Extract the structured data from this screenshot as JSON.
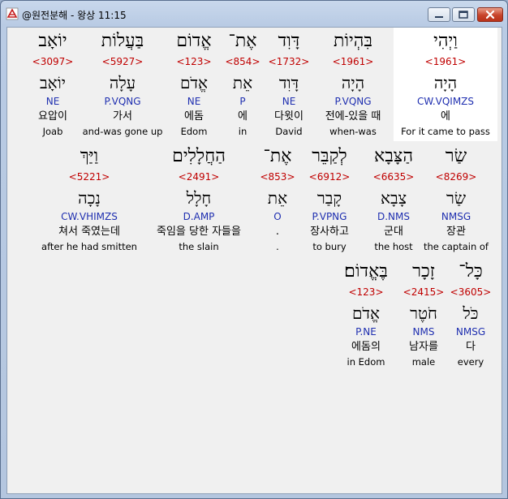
{
  "window": {
    "title": "@원전분해 - 왕상 11:15"
  },
  "rows": [
    [
      {
        "heb": "וַיְהִי",
        "strong": "<1961>",
        "lemma": "הָיָה",
        "morph": "CW.VQIMZS",
        "kor": "에",
        "eng": "For it came to pass"
      },
      {
        "heb": "בִּהְיוֹת",
        "strong": "<1961>",
        "lemma": "הָיָה",
        "morph": "P.VQNG",
        "kor": "전에-있을 때",
        "eng": "when-was"
      },
      {
        "heb": "דָּוִד",
        "strong": "<1732>",
        "lemma": "דָּוִד",
        "morph": "NE",
        "kor": "다윗이",
        "eng": "David"
      },
      {
        "heb": "אֶת־",
        "strong": "<854>",
        "lemma": "אֵת",
        "morph": "P",
        "kor": "에",
        "eng": "in"
      },
      {
        "heb": "אֱדוֹם",
        "strong": "<123>",
        "lemma": "אֱדֹם",
        "morph": "NE",
        "kor": "에돔",
        "eng": "Edom"
      },
      {
        "heb": "בַּעֲלוֹת",
        "strong": "<5927>",
        "lemma": "עָלָה",
        "morph": "P.VQNG",
        "kor": "가서",
        "eng": "and-was gone up"
      },
      {
        "heb": "יוֹאָב",
        "strong": "<3097>",
        "lemma": "יוֹאָב",
        "morph": "NE",
        "kor": "요압이",
        "eng": "Joab"
      }
    ],
    [
      {
        "heb": "שַׂר",
        "strong": "<8269>",
        "lemma": "שַׂר",
        "morph": "NMSG",
        "kor": "장관",
        "eng": "the captain of"
      },
      {
        "heb": "הַצָּבָא",
        "strong": "<6635>",
        "lemma": "צָבָא",
        "morph": "D.NMS",
        "kor": "군대",
        "eng": "the host"
      },
      {
        "heb": "לְקַבֵּר",
        "strong": "<6912>",
        "lemma": "קָבַר",
        "morph": "P.VPNG",
        "kor": "장사하고",
        "eng": "to bury"
      },
      {
        "heb": "אֶת־",
        "strong": "<853>",
        "lemma": "אֵת",
        "morph": "O",
        "kor": ".",
        "eng": "."
      },
      {
        "heb": "הַחֲלָלִים",
        "strong": "<2491>",
        "lemma": "חָלָל",
        "morph": "D.AMP",
        "kor": "죽임을 당한 자들을",
        "eng": "the slain"
      },
      {
        "heb": "וַיַּךְ",
        "strong": "<5221>",
        "lemma": "נָכָה",
        "morph": "CW.VHIMZS",
        "kor": "쳐서 죽였는데",
        "eng": "after he had smitten"
      }
    ],
    [
      {
        "heb": "כָּל־",
        "strong": "<3605>",
        "lemma": "כֹּל",
        "morph": "NMSG",
        "kor": "다",
        "eng": "every"
      },
      {
        "heb": "זָכָר",
        "strong": "<2415>",
        "lemma": "חֹטֶר",
        "morph": "NMS",
        "kor": "남자를",
        "eng": "male"
      },
      {
        "heb": "בֶּאֱדוֹם׃",
        "strong": "<123>",
        "lemma": "אֱדֹם",
        "morph": "P.NE",
        "kor": "에돔의",
        "eng": "in Edom"
      }
    ]
  ],
  "colors": {
    "strong": "#c00000",
    "morph": "#1f2fb0",
    "highlight": "#ffffff"
  },
  "icons": [
    "app-icon",
    "minimize-icon",
    "maximize-icon",
    "close-icon"
  ]
}
